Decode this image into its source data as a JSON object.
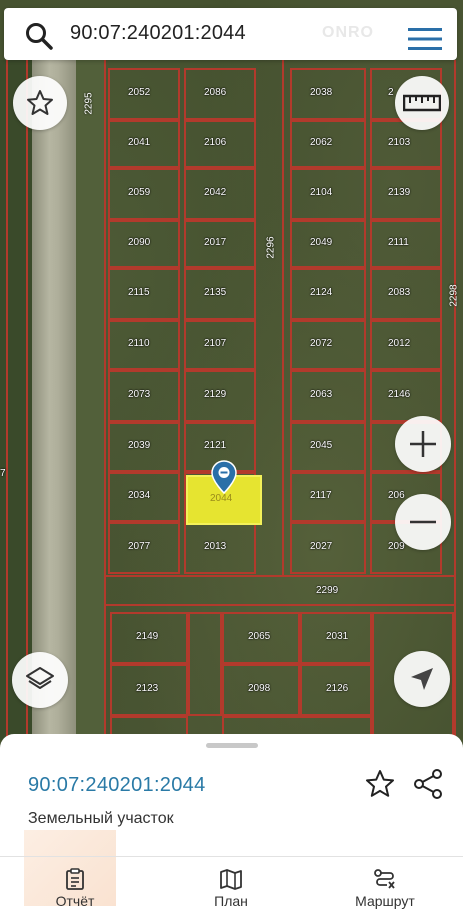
{
  "search": {
    "query": "90:07:240201:2044",
    "watermark": "ONRO"
  },
  "map": {
    "parcels": [
      {
        "label": "2052"
      },
      {
        "label": "2086"
      },
      {
        "label": "2038"
      },
      {
        "label": "2"
      },
      {
        "label": "2041"
      },
      {
        "label": "2106"
      },
      {
        "label": "2062"
      },
      {
        "label": "2103"
      },
      {
        "label": "2059"
      },
      {
        "label": "2042"
      },
      {
        "label": "2104"
      },
      {
        "label": "2139"
      },
      {
        "label": "2090"
      },
      {
        "label": "2017"
      },
      {
        "label": "2049"
      },
      {
        "label": "2111"
      },
      {
        "label": "2115"
      },
      {
        "label": "2135"
      },
      {
        "label": "2124"
      },
      {
        "label": "2083"
      },
      {
        "label": "2110"
      },
      {
        "label": "2107"
      },
      {
        "label": "2072"
      },
      {
        "label": "2012"
      },
      {
        "label": "2073"
      },
      {
        "label": "2129"
      },
      {
        "label": "2063"
      },
      {
        "label": "2146"
      },
      {
        "label": "2039"
      },
      {
        "label": "2121"
      },
      {
        "label": "2045"
      },
      {
        "label": "2034"
      },
      {
        "label": "2117"
      },
      {
        "label": "206"
      },
      {
        "label": "2077"
      },
      {
        "label": "2013"
      },
      {
        "label": "2027"
      },
      {
        "label": "209"
      },
      {
        "label": "2299"
      },
      {
        "label": "2149"
      },
      {
        "label": "2065"
      },
      {
        "label": "2031"
      },
      {
        "label": "2123"
      },
      {
        "label": "2098"
      },
      {
        "label": "2126"
      }
    ],
    "vertical_labels": [
      "2295",
      "2296",
      "2298",
      "7"
    ],
    "selected_label": "2044"
  },
  "sheet": {
    "cadastral_number": "90:07:240201:2044",
    "object_type": "Земельный участок",
    "tabs": [
      {
        "label": "Отчёт",
        "icon": "report-icon"
      },
      {
        "label": "План",
        "icon": "map-icon"
      },
      {
        "label": "Маршрут",
        "icon": "route-icon"
      }
    ]
  },
  "colors": {
    "parcel_border": "#b23a2c",
    "selected_fill": "#e6e430",
    "link_blue": "#2a7aa6"
  }
}
